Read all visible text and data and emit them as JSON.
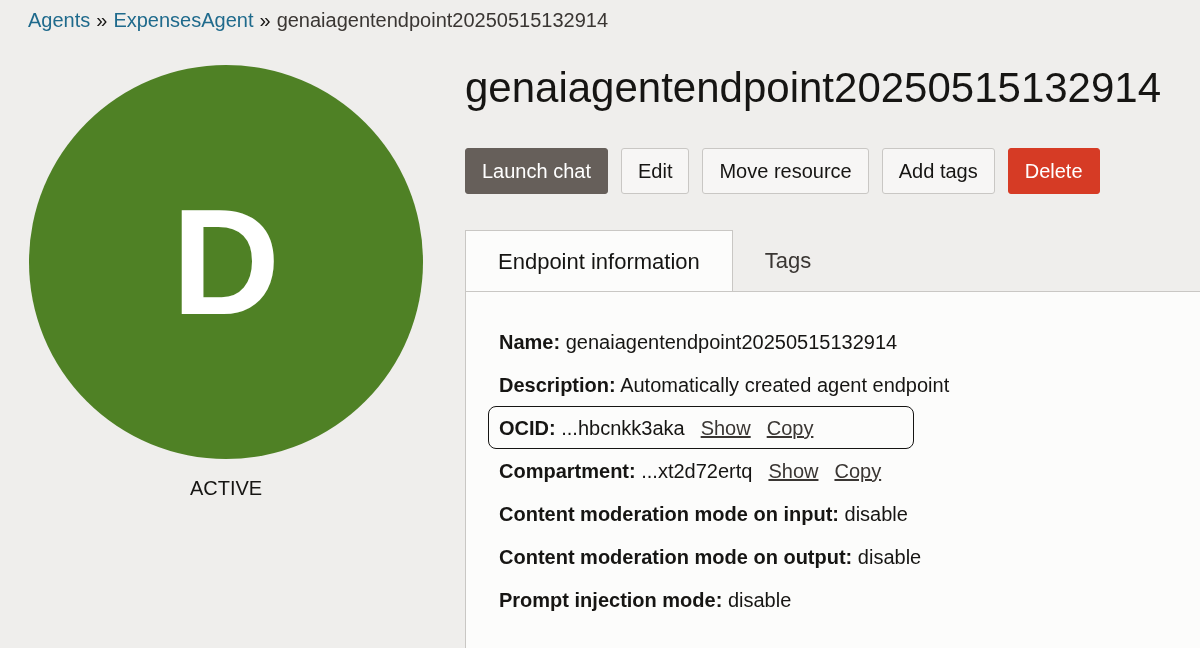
{
  "breadcrumb": [
    {
      "kind": "link",
      "text": "Agents"
    },
    {
      "kind": "separator",
      "text": "»"
    },
    {
      "kind": "link",
      "text": "ExpensesAgent"
    },
    {
      "kind": "separator",
      "text": "»"
    },
    {
      "kind": "current",
      "text": "genaiagentendpoint20250515132914"
    }
  ],
  "avatar": {
    "letter": "D",
    "color": "#4f8125",
    "status": "ACTIVE"
  },
  "title": "genaiagentendpoint20250515132914",
  "buttons": [
    {
      "label": "Launch chat",
      "kind": "primary"
    },
    {
      "label": "Edit",
      "kind": "secondary"
    },
    {
      "label": "Move resource",
      "kind": "secondary"
    },
    {
      "label": "Add tags",
      "kind": "secondary"
    },
    {
      "label": "Delete",
      "kind": "danger"
    }
  ],
  "tabs": [
    {
      "label": "Endpoint information",
      "selected": true
    },
    {
      "label": "Tags",
      "selected": false
    }
  ],
  "details": [
    {
      "label": "Name:",
      "value": "genaiagentendpoint20250515132914",
      "focused": false
    },
    {
      "label": "Description:",
      "value": "Automatically created agent endpoint",
      "focused": false
    },
    {
      "label": "OCID:",
      "value": "...hbcnkk3aka",
      "links": [
        "Show",
        "Copy"
      ],
      "focused": true
    },
    {
      "label": "Compartment:",
      "value": "...xt2d72ertq",
      "links": [
        "Show",
        "Copy"
      ],
      "focused": false
    },
    {
      "label": "Content moderation mode on input:",
      "value": "disable",
      "focused": false
    },
    {
      "label": "Content moderation mode on output:",
      "value": "disable",
      "focused": false
    },
    {
      "label": "Prompt injection mode:",
      "value": "disable",
      "focused": false
    }
  ]
}
